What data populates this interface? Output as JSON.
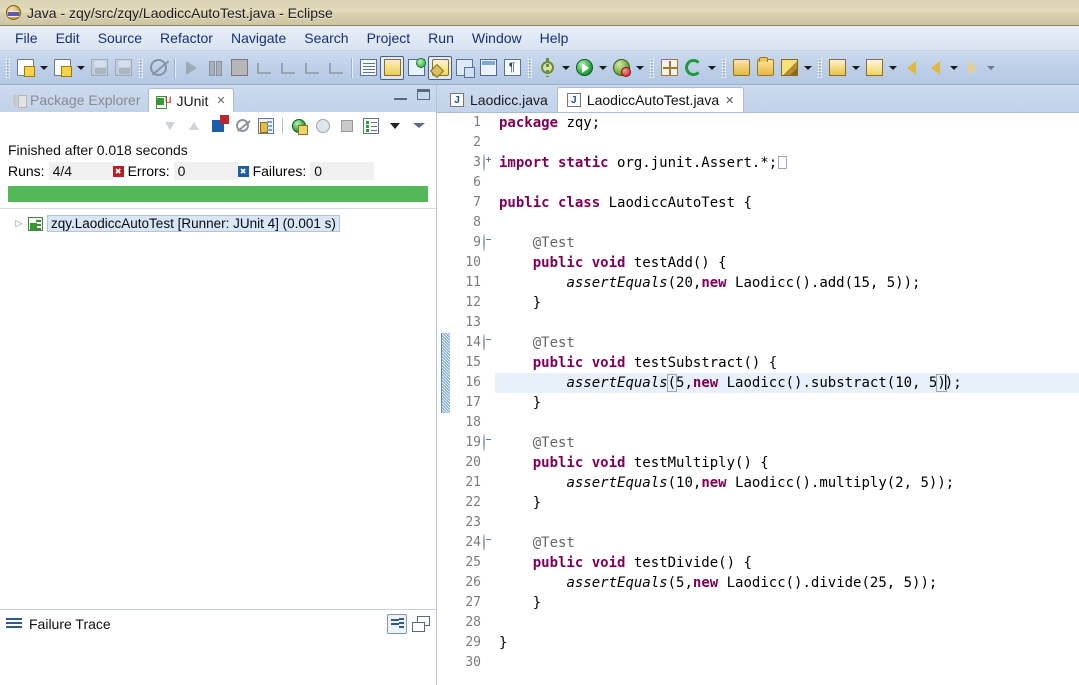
{
  "window": {
    "title": "Java - zqy/src/zqy/LaodiccAutoTest.java - Eclipse",
    "app_icon": "eclipse-icon"
  },
  "menubar": {
    "items": [
      {
        "label": "File"
      },
      {
        "label": "Edit"
      },
      {
        "label": "Source"
      },
      {
        "label": "Refactor"
      },
      {
        "label": "Navigate"
      },
      {
        "label": "Search"
      },
      {
        "label": "Project"
      },
      {
        "label": "Run"
      },
      {
        "label": "Window"
      },
      {
        "label": "Help"
      }
    ]
  },
  "toolbar": {
    "buttons": [
      {
        "name": "new-wizard",
        "icon": "new-document-icon"
      },
      {
        "name": "new-wizard-dropdown",
        "icon": "chevron-down-icon"
      },
      {
        "name": "new-java-class",
        "icon": "new-java-class-icon"
      },
      {
        "name": "new-java-class-dropdown",
        "icon": "chevron-down-icon"
      },
      {
        "name": "save",
        "icon": "save-icon"
      },
      {
        "name": "save-all",
        "icon": "save-all-icon"
      },
      {
        "name": "toggle-editable",
        "icon": "no-edit-icon"
      },
      {
        "name": "resume",
        "icon": "resume-icon"
      },
      {
        "name": "suspend",
        "icon": "suspend-icon"
      },
      {
        "name": "terminate",
        "icon": "terminate-icon"
      },
      {
        "name": "disconnect",
        "icon": "disconnect-icon"
      },
      {
        "name": "step-into",
        "icon": "step-into-icon"
      },
      {
        "name": "step-over",
        "icon": "step-over-icon"
      },
      {
        "name": "step-return",
        "icon": "step-return-icon"
      },
      {
        "name": "skip-breakpoints",
        "icon": "skip-breakpoints-icon"
      },
      {
        "name": "toggle-mark-occurrences",
        "icon": "mark-occurrences-icon"
      },
      {
        "name": "new-java-package",
        "icon": "new-package-icon"
      },
      {
        "name": "toggle-java-editor",
        "icon": "java-editor-icon"
      },
      {
        "name": "open-type",
        "icon": "open-type-icon"
      },
      {
        "name": "open-task",
        "icon": "open-task-icon"
      },
      {
        "name": "show-whitespace",
        "icon": "pilcrow-icon"
      },
      {
        "name": "debug",
        "icon": "debug-bug-icon"
      },
      {
        "name": "debug-dropdown",
        "icon": "chevron-down-icon"
      },
      {
        "name": "run",
        "icon": "run-play-icon"
      },
      {
        "name": "run-dropdown",
        "icon": "chevron-down-icon"
      },
      {
        "name": "run-coverage",
        "icon": "coverage-icon"
      },
      {
        "name": "run-coverage-dropdown",
        "icon": "chevron-down-icon"
      },
      {
        "name": "new-element",
        "icon": "new-element-icon"
      },
      {
        "name": "refresh",
        "icon": "refresh-icon"
      },
      {
        "name": "refresh-dropdown",
        "icon": "chevron-down-icon"
      },
      {
        "name": "open-resource",
        "icon": "open-folder-icon"
      },
      {
        "name": "open-folder",
        "icon": "folder-icon"
      },
      {
        "name": "quick-fix",
        "icon": "pencil-icon"
      },
      {
        "name": "quick-fix-dropdown",
        "icon": "chevron-down-icon"
      },
      {
        "name": "previous-annotation",
        "icon": "arrow-down-annotation-icon"
      },
      {
        "name": "previous-annotation-dropdown",
        "icon": "chevron-down-icon"
      },
      {
        "name": "next-annotation",
        "icon": "arrow-up-annotation-icon"
      },
      {
        "name": "next-annotation-dropdown",
        "icon": "chevron-down-icon"
      },
      {
        "name": "back-history",
        "icon": "back-arrow-yellow-icon"
      },
      {
        "name": "back",
        "icon": "back-arrow-icon"
      },
      {
        "name": "back-dropdown",
        "icon": "chevron-down-icon"
      },
      {
        "name": "forward",
        "icon": "forward-arrow-icon"
      },
      {
        "name": "forward-dropdown",
        "icon": "chevron-down-icon"
      }
    ]
  },
  "junit_view": {
    "tabs": [
      {
        "label": "Package Explorer",
        "active": false,
        "icon": "package-explorer-icon"
      },
      {
        "label": "JUnit",
        "active": true,
        "icon": "junit-icon",
        "closeable": true
      }
    ],
    "view_controls": [
      {
        "name": "minimize-view",
        "icon": "minimize-icon"
      },
      {
        "name": "maximize-view",
        "icon": "maximize-icon"
      }
    ],
    "toolbar": [
      {
        "name": "next-failure",
        "icon": "next-failure-arrow-icon"
      },
      {
        "name": "previous-failure",
        "icon": "previous-failure-arrow-icon"
      },
      {
        "name": "show-failures-only",
        "icon": "show-failures-only-icon"
      },
      {
        "name": "show-tests-in-hierarchy",
        "icon": "hierarchy-icon"
      },
      {
        "name": "scroll-lock",
        "icon": "scroll-lock-icon"
      },
      {
        "name": "rerun-test",
        "icon": "rerun-test-icon"
      },
      {
        "name": "rerun-failed-tests",
        "icon": "rerun-failed-tests-icon"
      },
      {
        "name": "stop-test-run",
        "icon": "stop-icon"
      },
      {
        "name": "test-run-history",
        "icon": "test-history-icon"
      },
      {
        "name": "view-menu",
        "icon": "view-menu-icon"
      },
      {
        "name": "minimize",
        "icon": "minimize-triangle-icon"
      }
    ],
    "status_text": "Finished after 0.018 seconds",
    "counters": {
      "runs_label": "Runs:",
      "runs_value": "4/4",
      "errors_label": "Errors:",
      "errors_value": "0",
      "failures_label": "Failures:",
      "failures_value": "0"
    },
    "progress": {
      "percent": 100,
      "color": "#53b857"
    },
    "tree": [
      {
        "label": "zqy.LaodiccAutoTest [Runner: JUnit 4] (0.001 s)",
        "icon": "test-suite-passed-icon",
        "twisty": "▷",
        "selected": true
      }
    ],
    "failure_trace": {
      "title": "Failure Trace",
      "icon": "failure-trace-icon",
      "tools": [
        {
          "name": "compare-results",
          "icon": "compare-results-icon"
        },
        {
          "name": "restore-view",
          "icon": "restore-icon"
        }
      ],
      "content": ""
    }
  },
  "editor": {
    "tabs": [
      {
        "label": "Laodicc.java",
        "active": false,
        "icon": "java-file-icon",
        "closeable": false
      },
      {
        "label": "LaodiccAutoTest.java",
        "active": true,
        "icon": "java-file-icon",
        "closeable": true
      }
    ],
    "current_line": 16,
    "change_bar_lines": [
      14,
      17
    ],
    "lines": [
      {
        "num": "1",
        "fold": "",
        "html": "<span class=\"kw\">package</span> zqy;"
      },
      {
        "num": "2",
        "fold": "",
        "html": ""
      },
      {
        "num": "3",
        "fold": "plus",
        "html": "<span class=\"kw\">import static</span> org.junit.Assert.*;<span class=\"folded-box\"></span>"
      },
      {
        "num": "6",
        "fold": "",
        "html": ""
      },
      {
        "num": "7",
        "fold": "",
        "html": "<span class=\"kw\">public class</span> LaodiccAutoTest {"
      },
      {
        "num": "8",
        "fold": "",
        "html": ""
      },
      {
        "num": "9",
        "fold": "minus",
        "html": "    <span class=\"ann\">@Test</span>"
      },
      {
        "num": "10",
        "fold": "",
        "html": "    <span class=\"kw\">public void</span> testAdd() {"
      },
      {
        "num": "11",
        "fold": "",
        "html": "        <span class=\"static-m\">assertEquals</span>(20,<span class=\"kw\">new</span> Laodicc().add(15, 5));"
      },
      {
        "num": "12",
        "fold": "",
        "html": "    }"
      },
      {
        "num": "13",
        "fold": "",
        "html": ""
      },
      {
        "num": "14",
        "fold": "minus",
        "html": "    <span class=\"ann\">@Test</span>"
      },
      {
        "num": "15",
        "fold": "",
        "html": "    <span class=\"kw\">public void</span> testSubstract() {"
      },
      {
        "num": "16",
        "fold": "",
        "html": "        <span class=\"static-m\">assertEquals</span><span class=\"bracket-box\">(</span>5,<span class=\"kw\">new</span> Laodicc().substract(10, 5<span class=\"bracket-box\">)</span><span class=\"caret\"></span>);"
      },
      {
        "num": "17",
        "fold": "",
        "html": "    }"
      },
      {
        "num": "18",
        "fold": "",
        "html": ""
      },
      {
        "num": "19",
        "fold": "minus",
        "html": "    <span class=\"ann\">@Test</span>"
      },
      {
        "num": "20",
        "fold": "",
        "html": "    <span class=\"kw\">public void</span> testMultiply() {"
      },
      {
        "num": "21",
        "fold": "",
        "html": "        <span class=\"static-m\">assertEquals</span>(10,<span class=\"kw\">new</span> Laodicc().multiply(2, 5));"
      },
      {
        "num": "22",
        "fold": "",
        "html": "    }"
      },
      {
        "num": "23",
        "fold": "",
        "html": ""
      },
      {
        "num": "24",
        "fold": "minus",
        "html": "    <span class=\"ann\">@Test</span>"
      },
      {
        "num": "25",
        "fold": "",
        "html": "    <span class=\"kw\">public void</span> testDivide() {"
      },
      {
        "num": "26",
        "fold": "",
        "html": "        <span class=\"static-m\">assertEquals</span>(5,<span class=\"kw\">new</span> Laodicc().divide(25, 5));"
      },
      {
        "num": "27",
        "fold": "",
        "html": "    }"
      },
      {
        "num": "28",
        "fold": "",
        "html": ""
      },
      {
        "num": "29",
        "fold": "",
        "html": "}"
      },
      {
        "num": "30",
        "fold": "",
        "html": ""
      }
    ]
  },
  "colors": {
    "titlebar": "#ddd5b6",
    "menubar": "#dfe8f5",
    "toolbar": "#bfd1e9",
    "keyword": "#7f0055",
    "annotation": "#646464",
    "progress_green": "#53b857",
    "current_line": "#e8f0fb",
    "selection": "#d8e6f7"
  }
}
